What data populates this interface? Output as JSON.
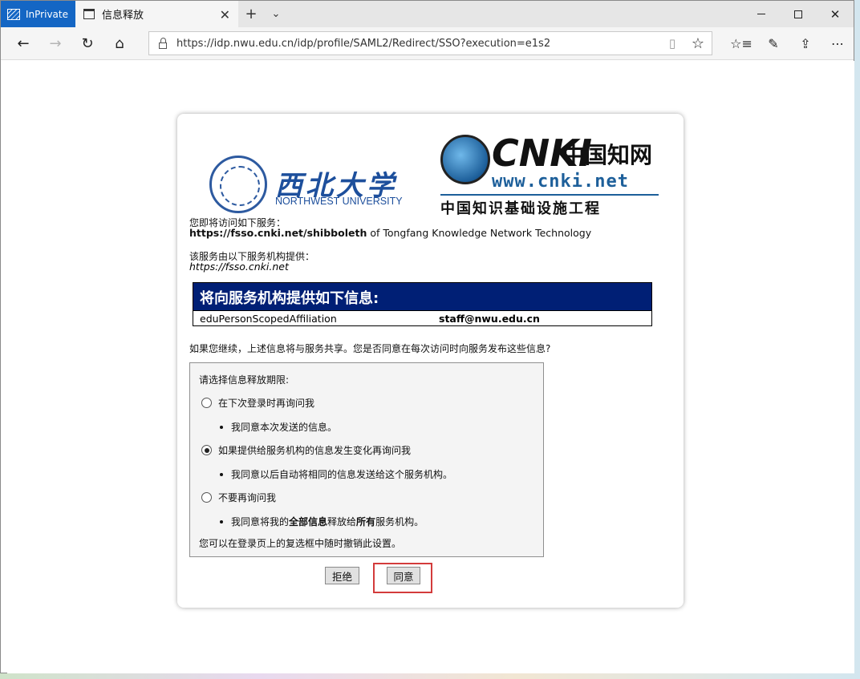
{
  "browser": {
    "inprivate_label": "InPrivate",
    "tab_title": "信息释放",
    "url": "https://idp.nwu.edu.cn/idp/profile/SAML2/Redirect/SSO?execution=e1s2"
  },
  "logos": {
    "nwu_name_cn": "西北大学",
    "nwu_name_en": "NORTHWEST UNIVERSITY",
    "cnki_word": "CNKI",
    "cnki_cn": "中国知网",
    "cnki_url": "www.cnki.net",
    "cnki_subtitle": "中国知识基础设施工程"
  },
  "service": {
    "intro": "您即将访问如下服务：",
    "entity": "https://fsso.cnki.net/shibboleth",
    "of_text": " of Tongfang Knowledge Network Technology",
    "provider_intro": "该服务由以下服务机构提供：",
    "provider_url": "https://fsso.cnki.net"
  },
  "attributes": {
    "heading": "将向服务机构提供如下信息:",
    "rows": [
      {
        "name": "eduPersonScopedAffiliation",
        "value": "staff@nwu.edu.cn"
      }
    ]
  },
  "consent": {
    "question": "如果您继续，上述信息将与服务共享。您是否同意在每次访问时向服务发布这些信息?",
    "legend": "请选择信息释放期限:",
    "options": [
      {
        "label": "在下次登录时再询问我",
        "desc": "我同意本次发送的信息。",
        "checked": false
      },
      {
        "label": "如果提供给服务机构的信息发生变化再询问我",
        "desc": "我同意以后自动将相同的信息发送给这个服务机构。",
        "checked": true
      },
      {
        "label": "不要再询问我",
        "desc_pre": "我同意将我的",
        "desc_b1": "全部信息",
        "desc_mid": "释放给",
        "desc_b2": "所有",
        "desc_post": "服务机构。",
        "checked": false
      }
    ],
    "note": "您可以在登录页上的复选框中随时撤销此设置。"
  },
  "buttons": {
    "reject": "拒绝",
    "accept": "同意"
  },
  "colors": {
    "attr_header_bg": "#001f75",
    "highlight": "#d33b3b",
    "inprivate": "#1466c4"
  }
}
